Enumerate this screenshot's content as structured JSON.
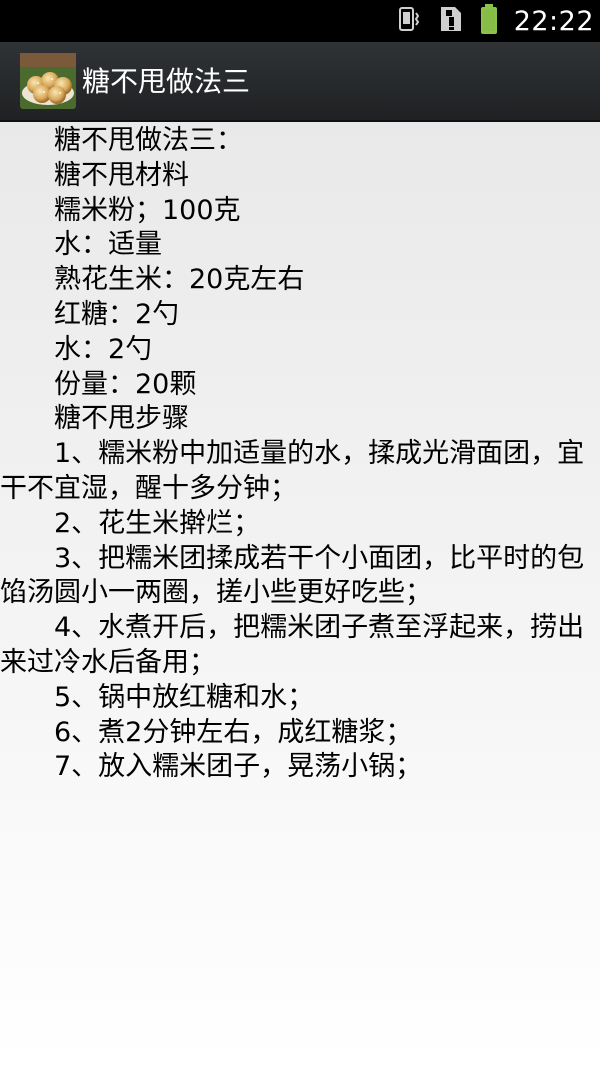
{
  "status_bar": {
    "time": "22:22",
    "icons": [
      "vibrate-icon",
      "sim-alert-icon",
      "battery-icon"
    ]
  },
  "action_bar": {
    "title": "糖不甩做法三",
    "app_icon": "food-thumbnail-icon"
  },
  "article": {
    "text": "　　糖不甩做法三：\n　　糖不甩材料\n　　糯米粉；100克\n　　水：适量\n　　熟花生米：20克左右\n　　红糖：2勺\n　　水：2勺\n　　份量：20颗\n　　糖不甩步骤\n　　1、糯米粉中加适量的水，揉成光滑面团，宜干不宜湿，醒十多分钟；\n　　2、花生米擀烂；\n　　3、把糯米团揉成若干个小面团，比平时的包馅汤圆小一两圈，搓小些更好吃些；\n　　4、水煮开后，把糯米团子煮至浮起来，捞出来过冷水后备用；\n　　5、锅中放红糖和水；\n　　6、煮2分钟左右，成红糖浆；\n　　7、放入糯米团子，晃荡小锅；"
  },
  "colors": {
    "status_bar": "#000000",
    "action_bar": "#2a2c2e",
    "battery": "#8bc34a",
    "text": "#000000"
  }
}
